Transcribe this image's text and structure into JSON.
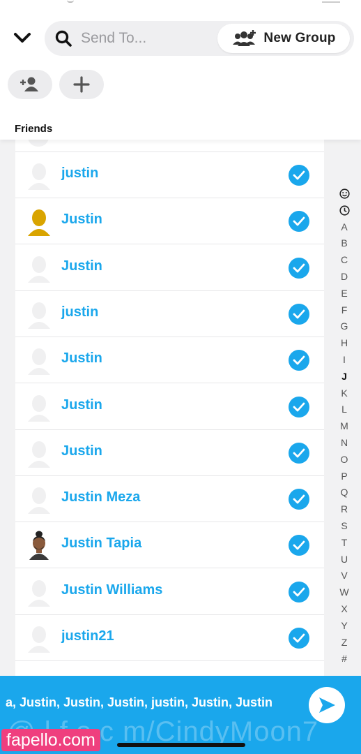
{
  "header": {
    "search": {
      "placeholder": "Send To..."
    },
    "new_group_label": "New Group",
    "section_title": "Friends"
  },
  "friends": [
    {
      "name": "justin",
      "avatar": "silhouette",
      "selected": true
    },
    {
      "name": "Justin",
      "avatar": "gold-silhouette",
      "selected": true
    },
    {
      "name": "Justin",
      "avatar": "silhouette",
      "selected": true
    },
    {
      "name": "justin",
      "avatar": "silhouette",
      "selected": true
    },
    {
      "name": "Justin",
      "avatar": "silhouette",
      "selected": true
    },
    {
      "name": "Justin",
      "avatar": "silhouette",
      "selected": true
    },
    {
      "name": "Justin",
      "avatar": "silhouette",
      "selected": true
    },
    {
      "name": "Justin Meza",
      "avatar": "silhouette",
      "selected": true
    },
    {
      "name": "Justin Tapia",
      "avatar": "bitmoji",
      "selected": true
    },
    {
      "name": "Justin Williams",
      "avatar": "silhouette",
      "selected": true
    },
    {
      "name": "justin21",
      "avatar": "silhouette",
      "selected": true
    }
  ],
  "alphabet": [
    "A",
    "B",
    "C",
    "D",
    "E",
    "F",
    "G",
    "H",
    "I",
    "J",
    "K",
    "L",
    "M",
    "N",
    "O",
    "P",
    "Q",
    "R",
    "S",
    "T",
    "U",
    "V",
    "W",
    "X",
    "Y",
    "Z",
    "#"
  ],
  "alphabet_active": "J",
  "send_bar": {
    "recipients": "a, Justin, Justin, Justin, justin, Justin, Justin"
  },
  "watermark": {
    "url": "@ l   f   s.c  m/CindyMoon7",
    "logo": "fapello.com"
  },
  "colors": {
    "accent": "#1aa7ec",
    "gold_avatar": "#d9a400",
    "watermark": "#ef3f7e"
  },
  "icons": {
    "back": "chevron-down-icon",
    "search": "search-icon",
    "new_group": "add-group-icon",
    "add_friend": "add-friend-icon",
    "plus": "plus-icon",
    "selected": "checkmark-icon",
    "send": "send-arrow-icon",
    "index_emoji": "smiley-icon",
    "index_recent": "clock-icon"
  }
}
